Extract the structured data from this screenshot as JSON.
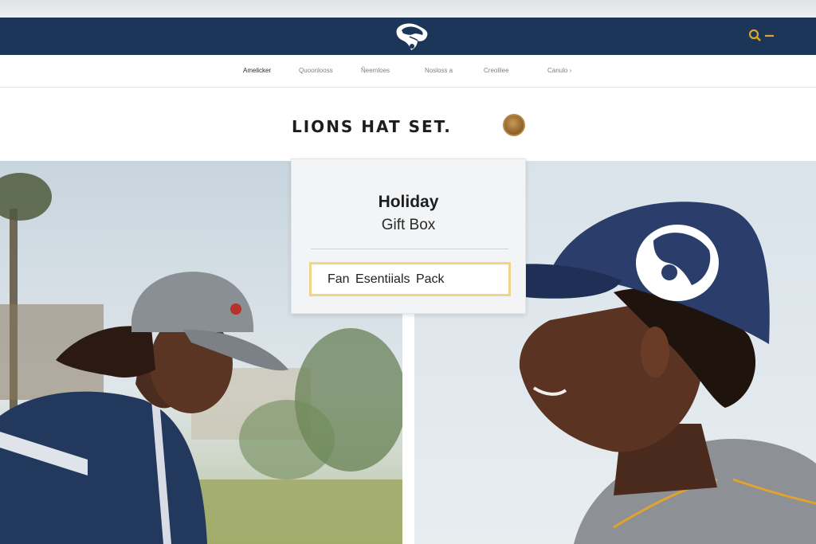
{
  "header": {
    "logo_icon": "bulldog-logo-icon",
    "search_icon": "search-icon",
    "brand_color": "#1b3658",
    "accent_color": "#e0a32b"
  },
  "nav": {
    "items": [
      {
        "label": "Amelicker",
        "active": true
      },
      {
        "label": "Quoonlooss"
      },
      {
        "label": "Ñeemloes"
      },
      {
        "label": "Nosloss a"
      },
      {
        "label": "Creolilee"
      },
      {
        "label": "Canulo ›"
      }
    ]
  },
  "page": {
    "title": "LIONS HAT SET.",
    "badge_icon": "emblem-badge-icon"
  },
  "card": {
    "title": "Holiday",
    "subtitle": "Gift Box",
    "field_value": "Fan Esentiials Pack",
    "field_border_color": "#f0d48a"
  },
  "photos": {
    "left": "man-in-grey-cap-photo",
    "right": "man-in-navy-cap-photo"
  }
}
